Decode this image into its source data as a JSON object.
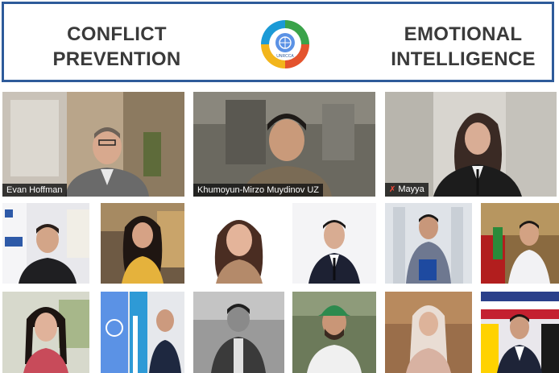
{
  "banner": {
    "left_title_line1": "CONFLICT",
    "left_title_line2": "PREVENTION",
    "right_title_line1": "EMOTIONAL",
    "right_title_line2": "INTELLIGENCE",
    "logo_icon": "un-emblem-circle-logo",
    "logo_caption": "UNRCCA",
    "border_color": "#2e5b9a"
  },
  "speakers": [
    {
      "name": "Evan Hoffman"
    },
    {
      "name": "Khumoyun-Mirzo Muydinov UZ"
    },
    {
      "name": "Mayya",
      "muted": true
    }
  ],
  "colors": {
    "name_label_bg": "#1a1a1a",
    "mic_muted": "#ff4c3b"
  }
}
